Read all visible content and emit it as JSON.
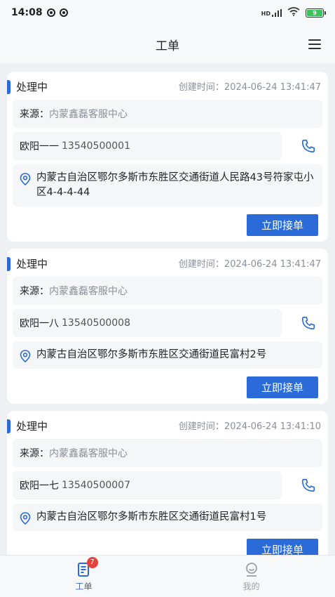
{
  "status": {
    "time": "14:08",
    "signal": "HD",
    "battery": "9"
  },
  "nav": {
    "title": "工单"
  },
  "orders": [
    {
      "status": "处理中",
      "created_label": "创建时间：",
      "created_time": "2024-06-24 13:41:47",
      "source_label": "来源：",
      "source_value": "内蒙鑫磊客服中心",
      "contact_name": "欧阳一一",
      "contact_phone": "13540500001",
      "address": "内蒙古自治区鄂尔多斯市东胜区交通街道人民路43号符家屯小区4-4-4-44",
      "action": "立即接单"
    },
    {
      "status": "处理中",
      "created_label": "创建时间：",
      "created_time": "2024-06-24 13:41:47",
      "source_label": "来源：",
      "source_value": "内蒙鑫磊客服中心",
      "contact_name": "欧阳一八",
      "contact_phone": "13540500008",
      "address": "内蒙古自治区鄂尔多斯市东胜区交通街道民富村2号",
      "action": "立即接单"
    },
    {
      "status": "处理中",
      "created_label": "创建时间：",
      "created_time": "2024-06-24 13:41:10",
      "source_label": "来源：",
      "source_value": "内蒙鑫磊客服中心",
      "contact_name": "欧阳一七",
      "contact_phone": "13540500007",
      "address": "内蒙古自治区鄂尔多斯市东胜区交通街道民富村1号",
      "action": "立即接单"
    }
  ],
  "tabs": [
    {
      "label": "工单",
      "badge": "7",
      "active": true
    },
    {
      "label": "我的",
      "active": false
    }
  ],
  "colors": {
    "accent": "#2a6bd8",
    "badge": "#e8413b",
    "battery": "#3ac45c"
  }
}
